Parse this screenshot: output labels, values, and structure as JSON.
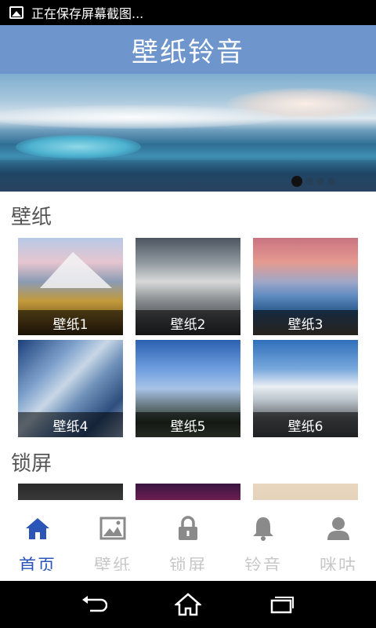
{
  "status_bar": {
    "text": "正在保存屏幕截图..."
  },
  "title_bar": {
    "title": "壁纸铃音"
  },
  "banner": {
    "slide_count": 4,
    "active_index": 0
  },
  "sections": {
    "wallpaper": {
      "title": "壁纸",
      "items": [
        "壁纸1",
        "壁纸2",
        "壁纸3",
        "壁纸4",
        "壁纸5",
        "壁纸6"
      ]
    },
    "lockscreen": {
      "title": "锁屏"
    }
  },
  "bottom_nav": {
    "items": [
      {
        "label": "首页",
        "icon": "home-icon",
        "active": true
      },
      {
        "label": "壁纸",
        "icon": "image-icon",
        "active": false
      },
      {
        "label": "锁屏",
        "icon": "lock-icon",
        "active": false
      },
      {
        "label": "铃音",
        "icon": "bell-icon",
        "active": false
      },
      {
        "label": "咪咕",
        "icon": "person-icon",
        "active": false
      }
    ]
  },
  "colors": {
    "accent": "#2b56b8",
    "title_bar": "#6e95cc",
    "inactive": "#c8c8c8"
  }
}
